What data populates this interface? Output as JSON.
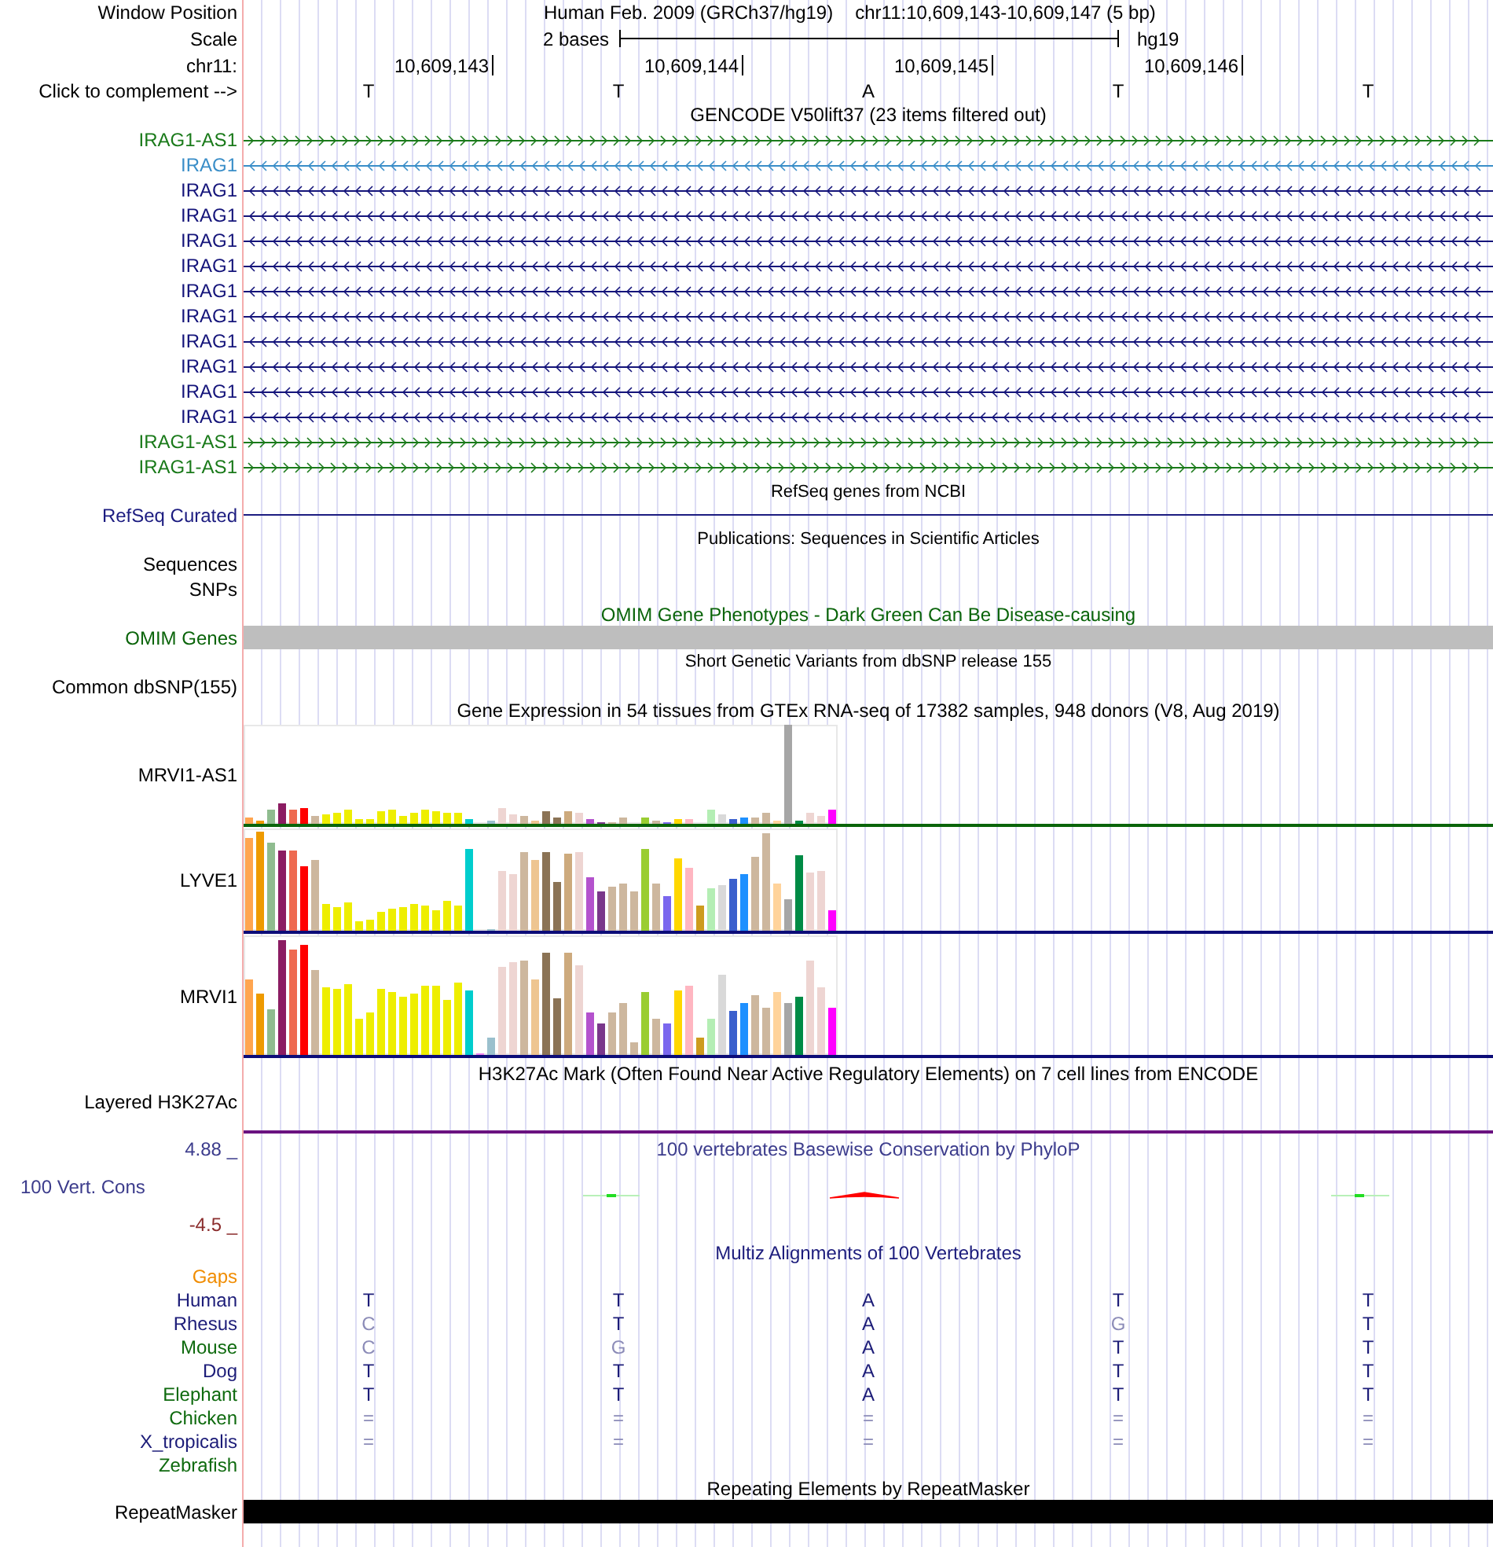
{
  "ruler": {
    "window_position": {
      "label": "Window Position",
      "assembly": "Human Feb. 2009 (GRCh37/hg19)",
      "range": "chr11:10,609,143-10,609,147 (5 bp)"
    },
    "scale": {
      "label": "Scale",
      "span": "2 bases",
      "assembly": "hg19"
    },
    "coordinates": {
      "label": "chr11:",
      "positions": [
        "10,609,143",
        "10,609,144",
        "10,609,145",
        "10,609,146"
      ]
    },
    "bases": {
      "label": "Click to complement -->",
      "values": [
        "T",
        "T",
        "A",
        "T",
        "T"
      ]
    }
  },
  "tracks": [
    {
      "kind": "genes",
      "title": "GENCODE V50lift37 (23 items filtered out)",
      "items": [
        {
          "name": "IRAG1-AS1",
          "forward": true,
          "color": "#1a7a1a"
        },
        {
          "name": "IRAG1",
          "forward": false,
          "color": "#3a8ec8"
        },
        {
          "name": "IRAG1",
          "forward": false,
          "color": "#14147a"
        },
        {
          "name": "IRAG1",
          "forward": false,
          "color": "#14147a"
        },
        {
          "name": "IRAG1",
          "forward": false,
          "color": "#14147a"
        },
        {
          "name": "IRAG1",
          "forward": false,
          "color": "#14147a"
        },
        {
          "name": "IRAG1",
          "forward": false,
          "color": "#14147a"
        },
        {
          "name": "IRAG1",
          "forward": false,
          "color": "#14147a"
        },
        {
          "name": "IRAG1",
          "forward": false,
          "color": "#14147a"
        },
        {
          "name": "IRAG1",
          "forward": false,
          "color": "#14147a"
        },
        {
          "name": "IRAG1",
          "forward": false,
          "color": "#14147a"
        },
        {
          "name": "IRAG1",
          "forward": false,
          "color": "#14147a"
        },
        {
          "name": "IRAG1-AS1",
          "forward": true,
          "color": "#1a7a1a"
        },
        {
          "name": "IRAG1-AS1",
          "forward": true,
          "color": "#1a7a1a"
        }
      ]
    },
    {
      "kind": "line",
      "title": "RefSeq genes from NCBI",
      "label": "RefSeq Curated"
    },
    {
      "kind": "labels",
      "title": "Publications: Sequences in Scientific Articles",
      "labels": [
        "Sequences",
        "SNPs"
      ]
    },
    {
      "kind": "bar",
      "title": "OMIM Gene Phenotypes - Dark Green Can Be Disease-causing",
      "label": "OMIM Genes"
    },
    {
      "kind": "empty",
      "title": "Short Genetic Variants from dbSNP release 155",
      "label": "Common dbSNP(155)"
    },
    {
      "kind": "expression",
      "title": "Gene Expression in 54 tissues from GTEx RNA-seq of 17382 samples, 948 donors (V8, Aug 2019)",
      "genes": [
        {
          "name": "MRVI1-AS1",
          "color": "#0a640a"
        },
        {
          "name": "LYVE1",
          "color": "#0c0c78"
        },
        {
          "name": "MRVI1",
          "color": "#0c0c78"
        }
      ]
    },
    {
      "kind": "layered",
      "title": "H3K27Ac Mark (Often Found Near Active Regulatory Elements) on 7 cell lines from ENCODE",
      "label": "Layered H3K27Ac"
    },
    {
      "kind": "conservation",
      "title": "100 vertebrates Basewise Conservation by PhyloP",
      "label": "100 Vert. Cons",
      "axis_max": "4.88 _",
      "axis_min": "-4.5 _"
    },
    {
      "kind": "alignment",
      "title": "Multiz Alignments of 100 Vertebrates",
      "gaps_label": "Gaps",
      "species": [
        {
          "name": "Human",
          "color": "#1c1c78",
          "bases": [
            {
              "base": "T",
              "match": true
            },
            {
              "base": "T",
              "match": true
            },
            {
              "base": "A",
              "match": true
            },
            {
              "base": "T",
              "match": true
            },
            {
              "base": "T",
              "match": true
            }
          ]
        },
        {
          "name": "Rhesus",
          "color": "#1c1c78",
          "bases": [
            {
              "base": "C",
              "match": false
            },
            {
              "base": "T",
              "match": true
            },
            {
              "base": "A",
              "match": true
            },
            {
              "base": "G",
              "match": false
            },
            {
              "base": "T",
              "match": true
            }
          ]
        },
        {
          "name": "Mouse",
          "color": "#0e6a0e",
          "bases": [
            {
              "base": "C",
              "match": false
            },
            {
              "base": "G",
              "match": false
            },
            {
              "base": "A",
              "match": true
            },
            {
              "base": "T",
              "match": true
            },
            {
              "base": "T",
              "match": true
            }
          ]
        },
        {
          "name": "Dog",
          "color": "#1c1c78",
          "bases": [
            {
              "base": "T",
              "match": true
            },
            {
              "base": "T",
              "match": true
            },
            {
              "base": "A",
              "match": true
            },
            {
              "base": "T",
              "match": true
            },
            {
              "base": "T",
              "match": true
            }
          ]
        },
        {
          "name": "Elephant",
          "color": "#0e6a0e",
          "bases": [
            {
              "base": "T",
              "match": true
            },
            {
              "base": "T",
              "match": true
            },
            {
              "base": "A",
              "match": true
            },
            {
              "base": "T",
              "match": true
            },
            {
              "base": "T",
              "match": true
            }
          ]
        },
        {
          "name": "Chicken",
          "color": "#0e6a0e",
          "bases": [
            {
              "base": "=",
              "match": false
            },
            {
              "base": "=",
              "match": false
            },
            {
              "base": "=",
              "match": false
            },
            {
              "base": "=",
              "match": false
            },
            {
              "base": "=",
              "match": false
            }
          ]
        },
        {
          "name": "X_tropicalis",
          "color": "#1c1c78",
          "bases": [
            {
              "base": "=",
              "match": false
            },
            {
              "base": "=",
              "match": false
            },
            {
              "base": "=",
              "match": false
            },
            {
              "base": "=",
              "match": false
            },
            {
              "base": "=",
              "match": false
            }
          ]
        },
        {
          "name": "Zebrafish",
          "color": "#0e6a0e"
        }
      ]
    },
    {
      "kind": "repeats",
      "title": "Repeating Elements by RepeatMasker",
      "label": "RepeatMasker"
    }
  ]
}
